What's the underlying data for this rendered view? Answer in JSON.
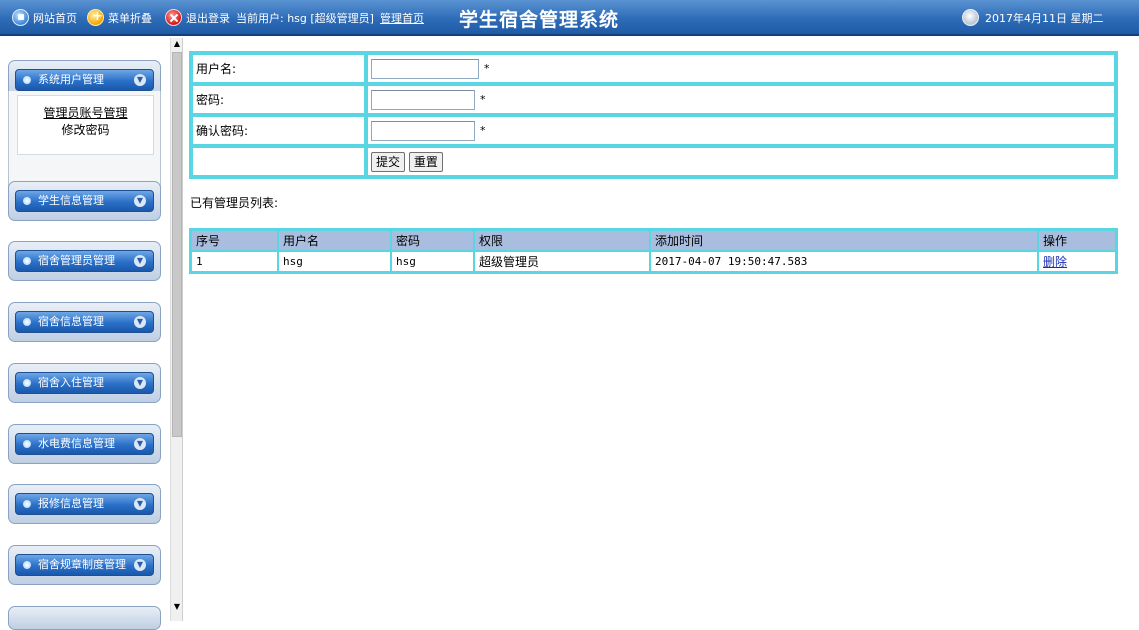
{
  "header": {
    "home_link": "网站首页",
    "favorite_link": "菜单折叠",
    "logout_link": "退出登录",
    "current_user": "当前用户: hsg [超级管理员]",
    "manage_home_link": "管理首页",
    "system_title": "学生宿舍管理系统",
    "date_text": "2017年4月11日 星期二",
    "brand_color": "#2e6cb8"
  },
  "sidebar": {
    "menus": [
      {
        "label": "系统用户管理"
      },
      {
        "label": "学生信息管理"
      },
      {
        "label": "宿舍管理员管理"
      },
      {
        "label": "宿舍信息管理"
      },
      {
        "label": "宿舍入住管理"
      },
      {
        "label": "水电费信息管理"
      },
      {
        "label": "报修信息管理"
      },
      {
        "label": "宿舍规章制度管理"
      }
    ],
    "submenu": {
      "items": [
        {
          "label": "管理员账号管理"
        },
        {
          "label": "修改密码"
        }
      ]
    }
  },
  "form": {
    "username_label": "用户名:",
    "password_label": "密码:",
    "confirm_label": "确认密码:",
    "username_value": "",
    "password_value": "",
    "confirm_value": "",
    "required_mark": "*",
    "submit_label": "提交",
    "reset_label": "重置",
    "border_color": "#5ad6e3"
  },
  "admin_list": {
    "title": "已有管理员列表:",
    "columns": [
      "序号",
      "用户名",
      "密码",
      "权限",
      "添加时间",
      "操作"
    ],
    "rows": [
      {
        "index": "1",
        "username": "hsg",
        "password": "hsg",
        "role": "超级管理员",
        "added_time": "2017-04-07 19:50:47.583",
        "action": "删除"
      }
    ],
    "header_color": "#a9bedf"
  }
}
